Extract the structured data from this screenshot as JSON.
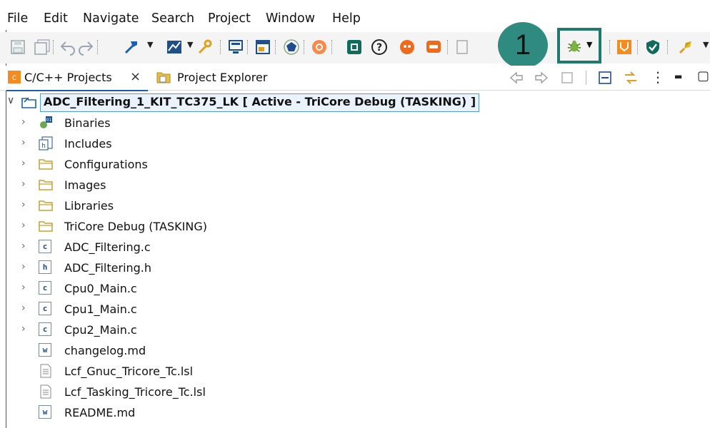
{
  "menu": [
    "File",
    "Edit",
    "Navigate",
    "Search",
    "Project",
    "Window",
    "Help"
  ],
  "callout": {
    "number": "1",
    "color": "#2f8b80"
  },
  "highlight_color": "#1f7a6e",
  "toolbar": {
    "icons": [
      "save-icon",
      "save-all-icon",
      "undo-icon",
      "redo-icon",
      "build-hammer-icon",
      "build-config-icon",
      "wrench-icon",
      "console-icon",
      "window-icon",
      "pentagon-icon",
      "target-icon",
      "chip-icon",
      "help-icon",
      "record-icon",
      "message-icon",
      "export-icon",
      "debug-bug-icon",
      "lightning-icon",
      "shield-icon",
      "rocket-icon"
    ]
  },
  "tabs": {
    "cpp_projects": "C/C++ Projects",
    "close": "×",
    "project_explorer": "Project Explorer"
  },
  "tree": {
    "root": "ADC_Filtering_1_KIT_TC375_LK [ Active - TriCore Debug (TASKING) ]",
    "items": [
      {
        "label": "Binaries",
        "icon": "binaries-icon",
        "expandable": true
      },
      {
        "label": "Includes",
        "icon": "includes-icon",
        "expandable": true
      },
      {
        "label": "Configurations",
        "icon": "folder-icon",
        "expandable": true
      },
      {
        "label": "Images",
        "icon": "folder-icon",
        "expandable": true
      },
      {
        "label": "Libraries",
        "icon": "folder-icon",
        "expandable": true
      },
      {
        "label": "TriCore Debug (TASKING)",
        "icon": "folder-icon",
        "expandable": true
      },
      {
        "label": "ADC_Filtering.c",
        "icon": "c-file-icon",
        "expandable": true
      },
      {
        "label": "ADC_Filtering.h",
        "icon": "h-file-icon",
        "expandable": true
      },
      {
        "label": "Cpu0_Main.c",
        "icon": "c-file-icon",
        "expandable": true
      },
      {
        "label": "Cpu1_Main.c",
        "icon": "c-file-icon",
        "expandable": true
      },
      {
        "label": "Cpu2_Main.c",
        "icon": "c-file-icon",
        "expandable": true
      },
      {
        "label": "changelog.md",
        "icon": "md-file-icon",
        "expandable": false
      },
      {
        "label": "Lcf_Gnuc_Tricore_Tc.lsl",
        "icon": "text-file-icon",
        "expandable": false
      },
      {
        "label": "Lcf_Tasking_Tricore_Tc.lsl",
        "icon": "text-file-icon",
        "expandable": false
      },
      {
        "label": "README.md",
        "icon": "md-file-icon",
        "expandable": false
      }
    ]
  },
  "glyphs": {
    "chevron_down": "∨",
    "chevron_right": "›",
    "c": "c",
    "h": "h",
    "w": "w",
    "dropdown": "▼",
    "collapse": "▭",
    "menu_dots": "⋮",
    "minimize": "▬",
    "maximize": "▢"
  }
}
